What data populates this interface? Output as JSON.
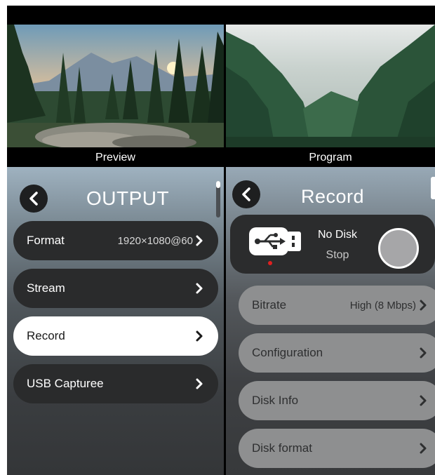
{
  "preview": {
    "label": "Preview"
  },
  "program": {
    "label": "Program"
  },
  "output_menu": {
    "title": "OUTPUT",
    "items": [
      {
        "label": "Format",
        "value": "1920×1080@60"
      },
      {
        "label": "Stream",
        "value": ""
      },
      {
        "label": "Record",
        "value": ""
      },
      {
        "label": "USB Capturee",
        "value": ""
      }
    ],
    "selected": "Record"
  },
  "record_menu": {
    "title": "Record",
    "disk": {
      "status": "No Disk",
      "state": "Stop"
    },
    "items": [
      {
        "label": "Bitrate",
        "value": "High (8 Mbps)"
      },
      {
        "label": "Configuration",
        "value": ""
      },
      {
        "label": "Disk Info",
        "value": ""
      },
      {
        "label": "Disk format",
        "value": ""
      }
    ]
  },
  "colors": {
    "selected_row": "#ffffff",
    "dark_row": "#2a2b2c",
    "grey_row": "#8e8f90",
    "record_indicator": "#e02020"
  },
  "icons": [
    "back-icon",
    "chevron-right-icon",
    "usb-drive-icon",
    "record-button"
  ]
}
